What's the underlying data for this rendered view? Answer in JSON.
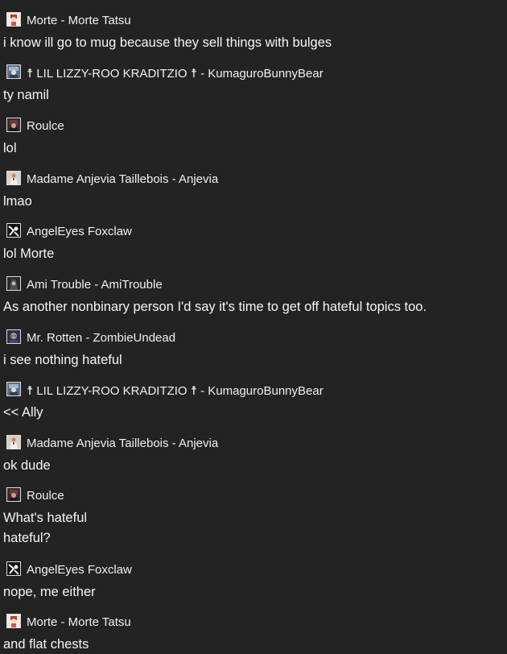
{
  "chat": {
    "messages": [
      {
        "user": "Morte - Morte Tatsu",
        "avatar_icon": "anime-character-avatar-red",
        "lines": [
          "i know ill go to mug because they sell things with bulges"
        ]
      },
      {
        "user": "☨ LIL LIZZY-ROO KRADITZIO ☨ - KumaguroBunnyBear",
        "avatar_icon": "anime-character-avatar-blue",
        "lines": [
          "ty namil"
        ]
      },
      {
        "user": "Roulce",
        "avatar_icon": "dark-character-avatar",
        "lines": [
          "lol"
        ]
      },
      {
        "user": "Madame Anjevia Taillebois - Anjevia",
        "avatar_icon": "character-avatar-white-dress",
        "lines": [
          "lmao"
        ]
      },
      {
        "user": "AngelEyes Foxclaw",
        "avatar_icon": "black-white-character-avatar",
        "lines": [
          "lol Morte"
        ]
      },
      {
        "user": "Ami Trouble - AmiTrouble",
        "avatar_icon": "dark-hooded-character-avatar",
        "lines": [
          "As another nonbinary person I'd say it's time to get off hateful topics too."
        ]
      },
      {
        "user": "Mr. Rotten - ZombieUndead",
        "avatar_icon": "zombie-character-avatar",
        "lines": [
          "i see nothing hateful"
        ]
      },
      {
        "user": "☨ LIL LIZZY-ROO KRADITZIO ☨ - KumaguroBunnyBear",
        "avatar_icon": "anime-character-avatar-blue",
        "lines": [
          "<< Ally"
        ]
      },
      {
        "user": "Madame Anjevia Taillebois - Anjevia",
        "avatar_icon": "character-avatar-white-dress",
        "lines": [
          "ok dude"
        ]
      },
      {
        "user": "Roulce",
        "avatar_icon": "dark-character-avatar",
        "lines": [
          "What's hateful",
          "hateful?"
        ]
      },
      {
        "user": "AngelEyes Foxclaw",
        "avatar_icon": "black-white-character-avatar",
        "lines": [
          "nope, me either"
        ]
      },
      {
        "user": "Morte - Morte Tatsu",
        "avatar_icon": "anime-character-avatar-red",
        "lines": [
          "and flat chests"
        ]
      }
    ]
  },
  "colors": {
    "background": "#232323",
    "text": "#f5f5f5"
  }
}
